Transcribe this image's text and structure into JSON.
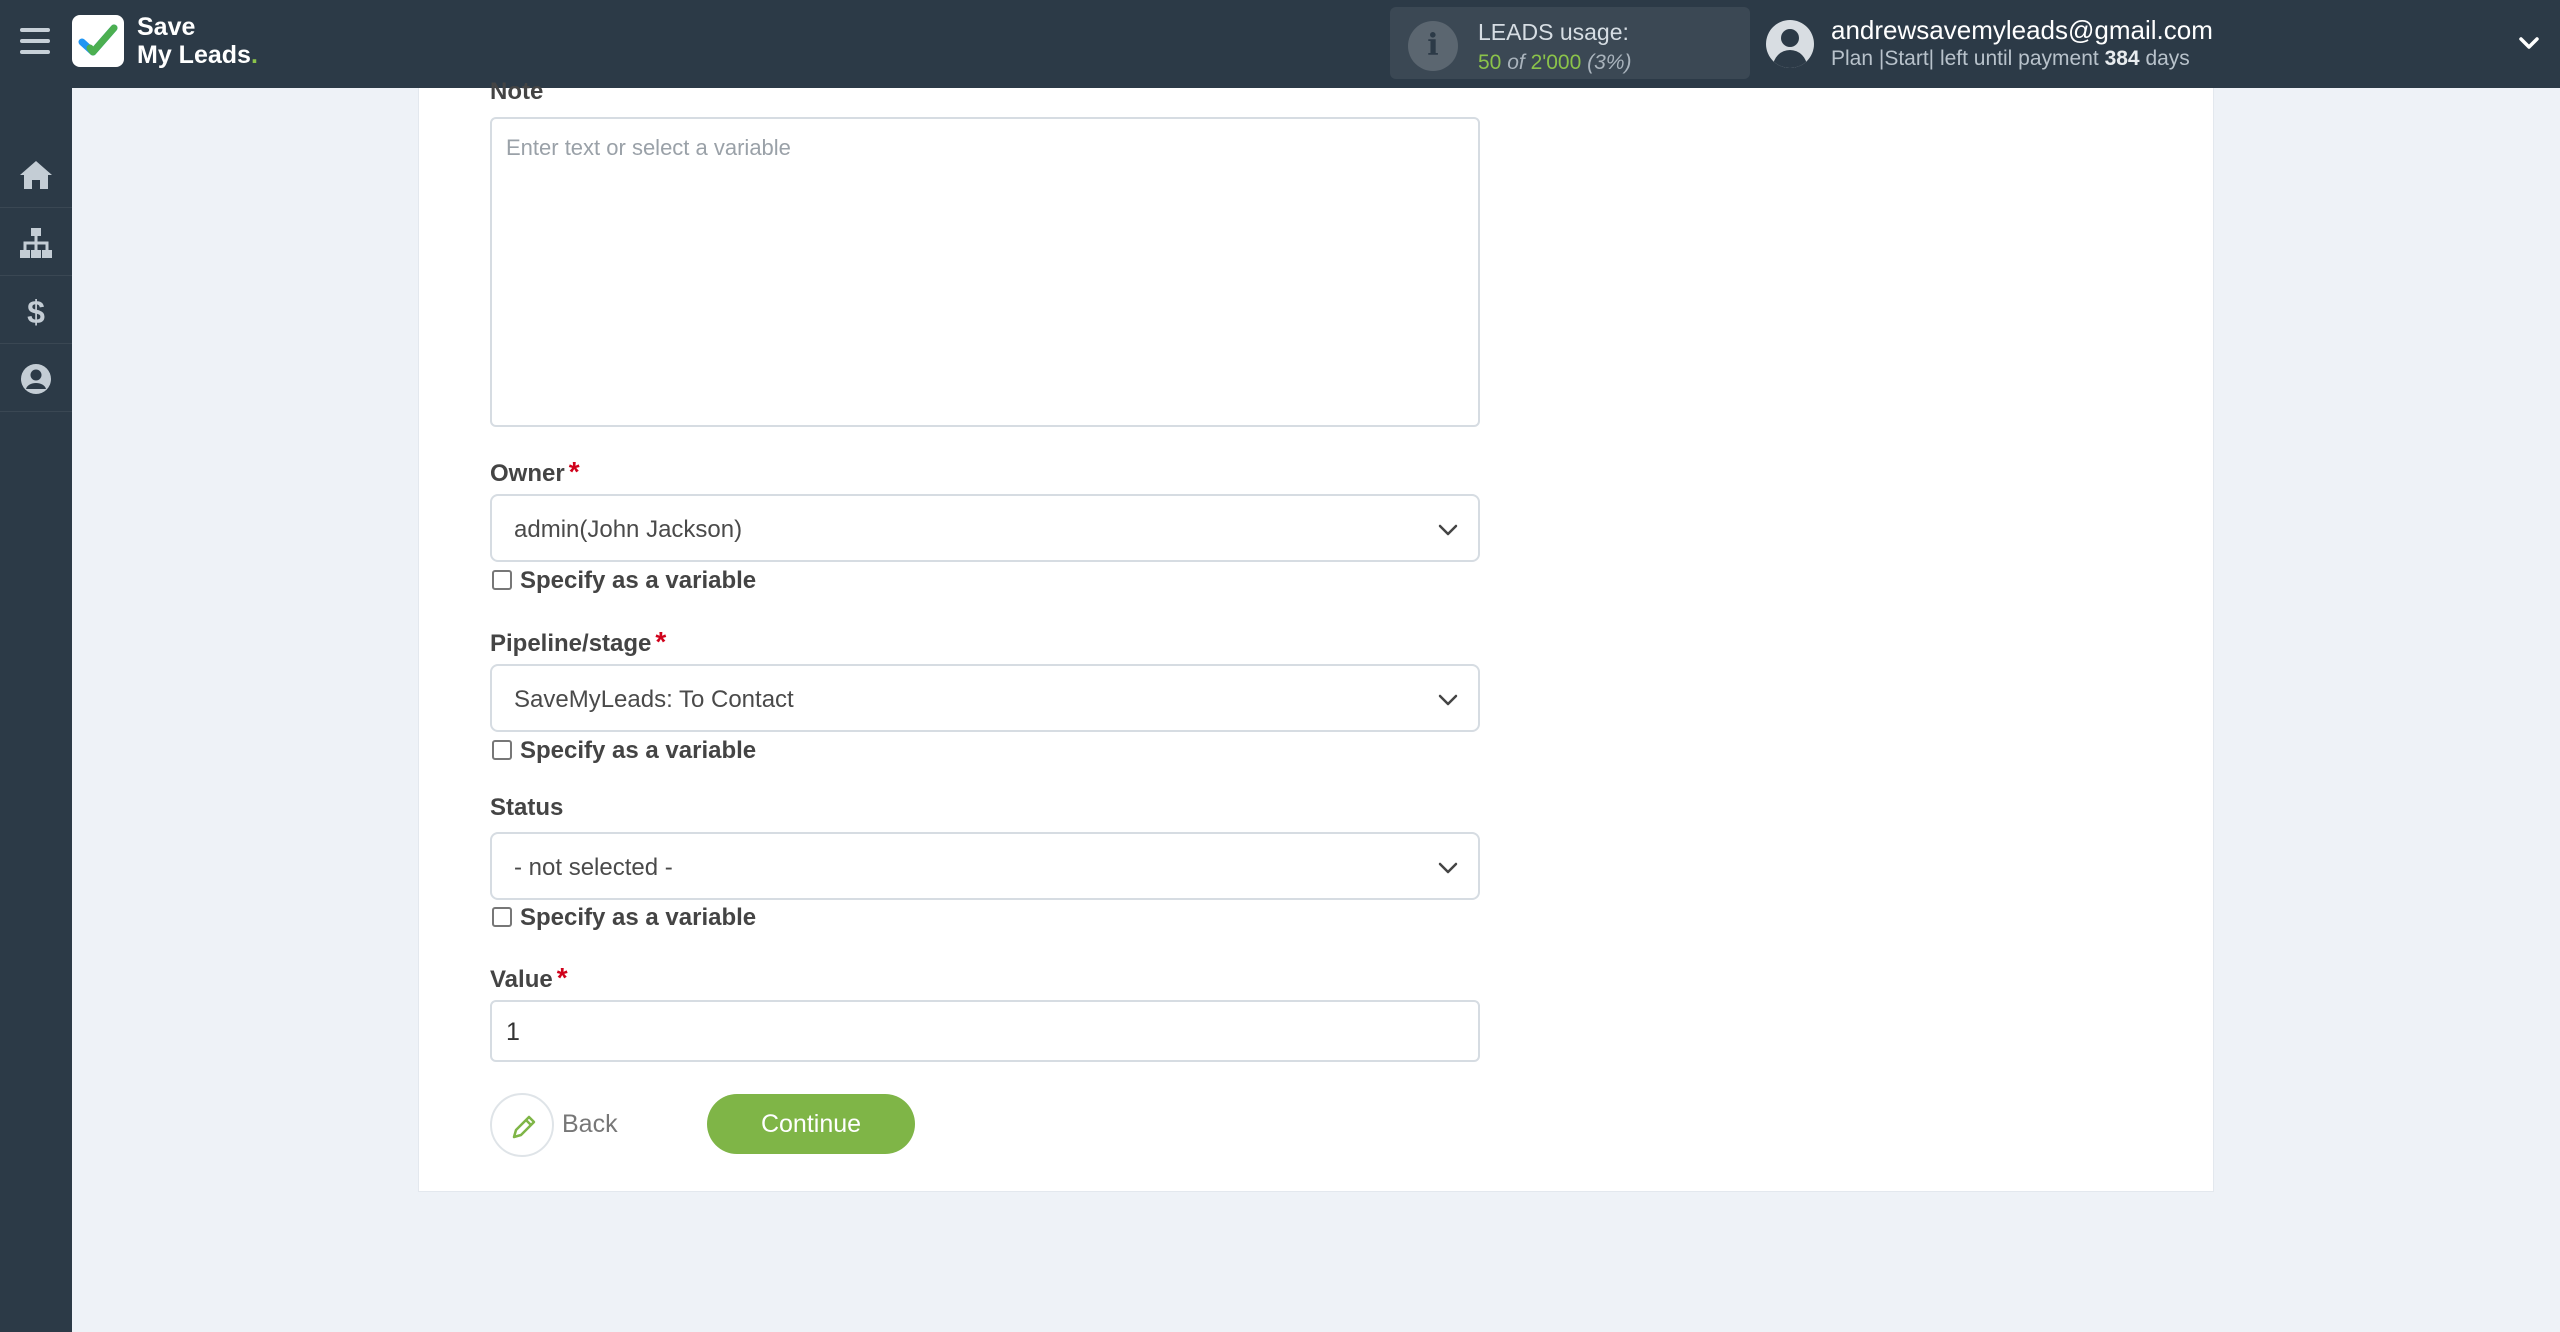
{
  "app": {
    "logo_line1": "Save",
    "logo_line2": "My Leads",
    "logo_dot": "."
  },
  "usage": {
    "label": "LEADS usage:",
    "used": "50",
    "of": "of",
    "limit": "2'000",
    "percent": "(3%)"
  },
  "user": {
    "email": "andrewsavemyleads@gmail.com",
    "plan_prefix": "Plan |Start| left until payment",
    "days_number": "384",
    "days_suffix": "days"
  },
  "sidebar": {
    "items": [
      {
        "icon": "home-icon"
      },
      {
        "icon": "sitemap-icon"
      },
      {
        "icon": "dollar-icon"
      },
      {
        "icon": "user-circle-icon"
      }
    ]
  },
  "form": {
    "note": {
      "label": "Note",
      "placeholder": "Enter text or select a variable"
    },
    "owner": {
      "label": "Owner",
      "required_mark": "*",
      "value": "admin(John Jackson)",
      "checkbox_label": "Specify as a variable"
    },
    "pipeline": {
      "label": "Pipeline/stage",
      "required_mark": "*",
      "value": "SaveMyLeads: To Contact",
      "checkbox_label": "Specify as a variable"
    },
    "status": {
      "label": "Status",
      "value": "- not selected -",
      "checkbox_label": "Specify as a variable"
    },
    "value_field": {
      "label": "Value",
      "required_mark": "*",
      "value": "1"
    }
  },
  "actions": {
    "back_label": "Back",
    "continue_label": "Continue"
  },
  "colors": {
    "accent": "#7fb547",
    "topbar": "#2c3a47",
    "required": "#d0021b"
  }
}
